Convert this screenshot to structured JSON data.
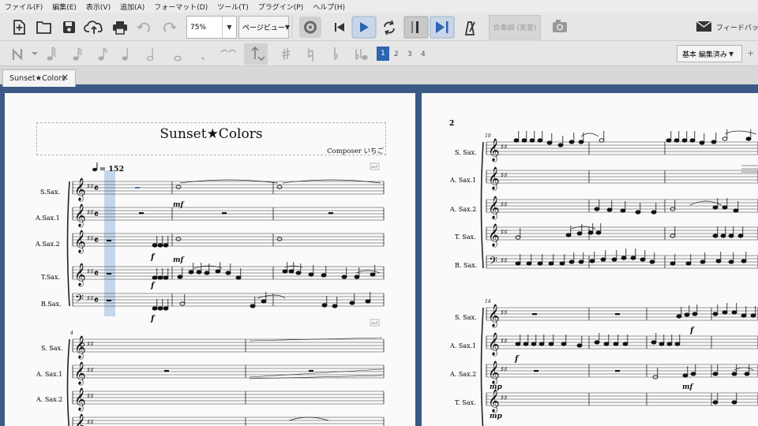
{
  "menu": [
    "ファイル(F)",
    "編集(E)",
    "表示(V)",
    "追加(A)",
    "フォーマット(D)",
    "ツール(T)",
    "プラグイン(P)",
    "ヘルプ(H)"
  ],
  "toolbar": {
    "zoom": "75%",
    "view_mode": "ページビュー",
    "concert_pitch": "合奏調 (実音)",
    "feedback": "フィードバック",
    "workspace": "基本 編集済み"
  },
  "voices": [
    "1",
    "2",
    "3",
    "4"
  ],
  "tab": {
    "title": "Sunset★Colors"
  },
  "score": {
    "title": "Sunset★Colors",
    "composer": "Composer いちご",
    "tempo_value": "= 152",
    "page2_number": "2",
    "system1_measure": "",
    "system2_measure": "4",
    "system3_measure": "10",
    "system4_measure": "14",
    "page1_instruments": [
      "S.Sax.",
      "A.Sax.1",
      "A.Sax.2",
      "T.Sax.",
      "B.Sax."
    ],
    "page1_instruments_short": [
      "S. Sax.",
      "A. Sax.1",
      "A. Sax.2"
    ],
    "page2_instruments": [
      "S. Sax.",
      "A. Sax.1",
      "A. Sax.2",
      "T. Sax.",
      "B. Sax."
    ],
    "page2_instruments_b": [
      "S. Sax.",
      "A. Sax.1",
      "A. Sax.2",
      "T. Sax."
    ],
    "dynamics": {
      "mf": "mf",
      "f": "f",
      "mp": "mp"
    }
  }
}
